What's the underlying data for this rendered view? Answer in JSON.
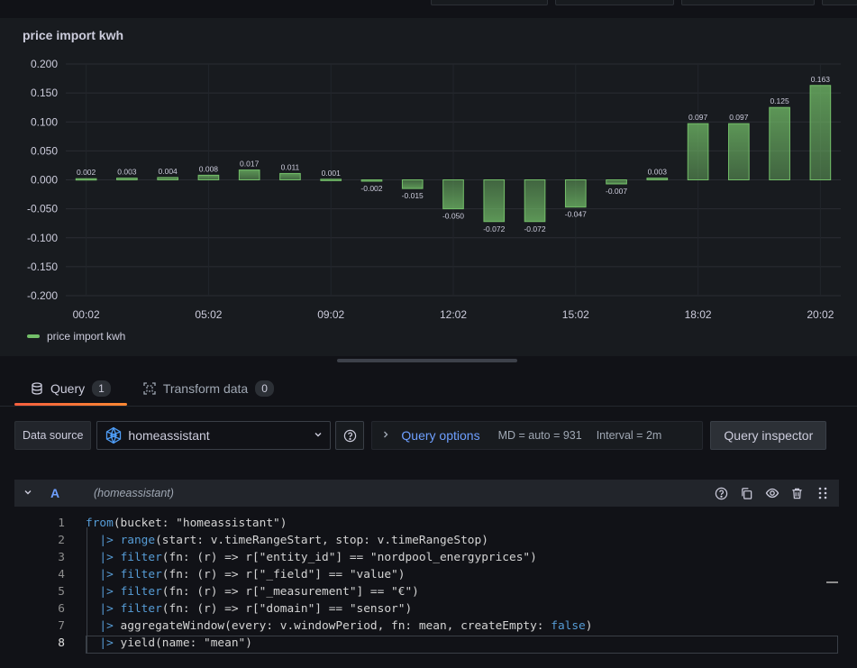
{
  "panel": {
    "title": "price import kwh"
  },
  "chart_data": {
    "type": "bar",
    "title": "price import kwh",
    "xlabel": "",
    "ylabel": "",
    "ylim": [
      -0.2,
      0.2
    ],
    "yticks": [
      "0.200",
      "0.150",
      "0.100",
      "0.050",
      "0.000",
      "-0.050",
      "-0.100",
      "-0.150",
      "-0.200"
    ],
    "yticks_values": [
      0.2,
      0.15,
      0.1,
      0.05,
      0.0,
      -0.05,
      -0.1,
      -0.15,
      -0.2
    ],
    "xticks": [
      "00:02",
      "05:02",
      "09:02",
      "12:02",
      "15:02",
      "18:02",
      "20:02"
    ],
    "xticks_index": [
      0,
      3,
      6,
      9,
      12,
      15,
      18
    ],
    "values": [
      0.002,
      0.003,
      0.004,
      0.008,
      0.017,
      0.011,
      0.001,
      -0.002,
      -0.015,
      -0.05,
      -0.072,
      -0.072,
      -0.047,
      -0.007,
      0.003,
      0.097,
      0.097,
      0.125,
      0.163
    ],
    "labels": [
      "0.002",
      "0.003",
      "0.004",
      "0.008",
      "0.017",
      "0.011",
      "0.001",
      "-0.002",
      "-0.015",
      "-0.050",
      "-0.072",
      "-0.072",
      "-0.047",
      "-0.007",
      "0.003",
      "0.097",
      "0.097",
      "0.125",
      "0.163"
    ],
    "series": [
      {
        "name": "price import kwh",
        "color": "#73bf69"
      }
    ],
    "grid": true,
    "legend": "bottom-left"
  },
  "legend": {
    "label": "price import kwh"
  },
  "tabs": [
    {
      "label": "Query",
      "count": "1",
      "icon": "database-icon",
      "active": true
    },
    {
      "label": "Transform data",
      "count": "0",
      "icon": "transform-icon",
      "active": false
    }
  ],
  "datasource": {
    "label": "Data source",
    "value": "homeassistant",
    "icon": "influxdb-icon"
  },
  "query_options": {
    "title": "Query options",
    "md": "MD = auto = 931",
    "interval": "Interval = 2m"
  },
  "inspector": {
    "label": "Query inspector"
  },
  "query": {
    "ref_id": "A",
    "datasource": "(homeassistant)"
  },
  "code": [
    {
      "n": "1",
      "html": "<span class=\"fn\">from</span>(bucket: \"homeassistant\")"
    },
    {
      "n": "2",
      "html": "  <span class=\"pipe\">|&gt;</span> <span class=\"fn\">range</span>(start: v.timeRangeStart, stop: v.timeRangeStop)"
    },
    {
      "n": "3",
      "html": "  <span class=\"pipe\">|&gt;</span> <span class=\"fn\">filter</span>(fn: (r) =&gt; r[\"entity_id\"] == \"nordpool_energyprices\")"
    },
    {
      "n": "4",
      "html": "  <span class=\"pipe\">|&gt;</span> <span class=\"fn\">filter</span>(fn: (r) =&gt; r[\"_field\"] == \"value\")"
    },
    {
      "n": "5",
      "html": "  <span class=\"pipe\">|&gt;</span> <span class=\"fn\">filter</span>(fn: (r) =&gt; r[\"_measurement\"] == \"€\")"
    },
    {
      "n": "6",
      "html": "  <span class=\"pipe\">|&gt;</span> <span class=\"fn\">filter</span>(fn: (r) =&gt; r[\"domain\"] == \"sensor\")"
    },
    {
      "n": "7",
      "html": "  <span class=\"pipe\">|&gt;</span> aggregateWindow(every: v.windowPeriod, fn: mean, createEmpty: <span class=\"kw\">false</span>)"
    },
    {
      "n": "8",
      "html": "  <span class=\"pipe\">|&gt;</span> yield(name: \"mean\")"
    }
  ],
  "code_text": [
    "from(bucket: \"homeassistant\")",
    "  |> range(start: v.timeRangeStart, stop: v.timeRangeStop)",
    "  |> filter(fn: (r) => r[\"entity_id\"] == \"nordpool_energyprices\")",
    "  |> filter(fn: (r) => r[\"_field\"] == \"value\")",
    "  |> filter(fn: (r) => r[\"_measurement\"] == \"€\")",
    "  |> filter(fn: (r) => r[\"domain\"] == \"sensor\")",
    "  |> aggregateWindow(every: v.windowPeriod, fn: mean, createEmpty: false)",
    "  |> yield(name: \"mean\")"
  ],
  "colors": {
    "accent": "#6e9fff",
    "bar": "#73bf69",
    "tab_underline": "#ff8833"
  }
}
